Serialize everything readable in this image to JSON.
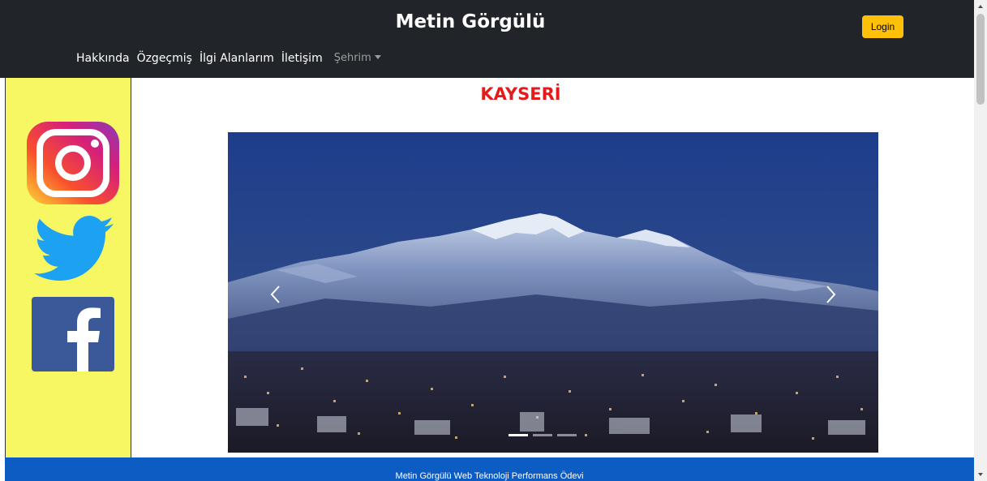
{
  "header": {
    "brand": "Metin Görgülü",
    "login_label": "Login",
    "nav": [
      "Hakkında",
      "Özgeçmiş",
      "İlgi Alanlarım",
      "İletişim"
    ],
    "dropdown_label": "Şehrim"
  },
  "sidebar": {
    "icons": [
      "instagram-icon",
      "twitter-icon",
      "facebook-icon"
    ]
  },
  "main": {
    "title": "KAYSERİ",
    "carousel": {
      "slide_count": 3,
      "active_index": 0,
      "prev_icon": "chevron-left-icon",
      "next_icon": "chevron-right-icon"
    }
  },
  "footer": {
    "text": "Metin Görgülü Web Teknoloji Performans Ödevi"
  },
  "colors": {
    "navbar": "#212529",
    "login_button": "#ffc107",
    "sidebar": "#f7f763",
    "title": "#e31b1b",
    "footer": "#0d5cc4"
  }
}
